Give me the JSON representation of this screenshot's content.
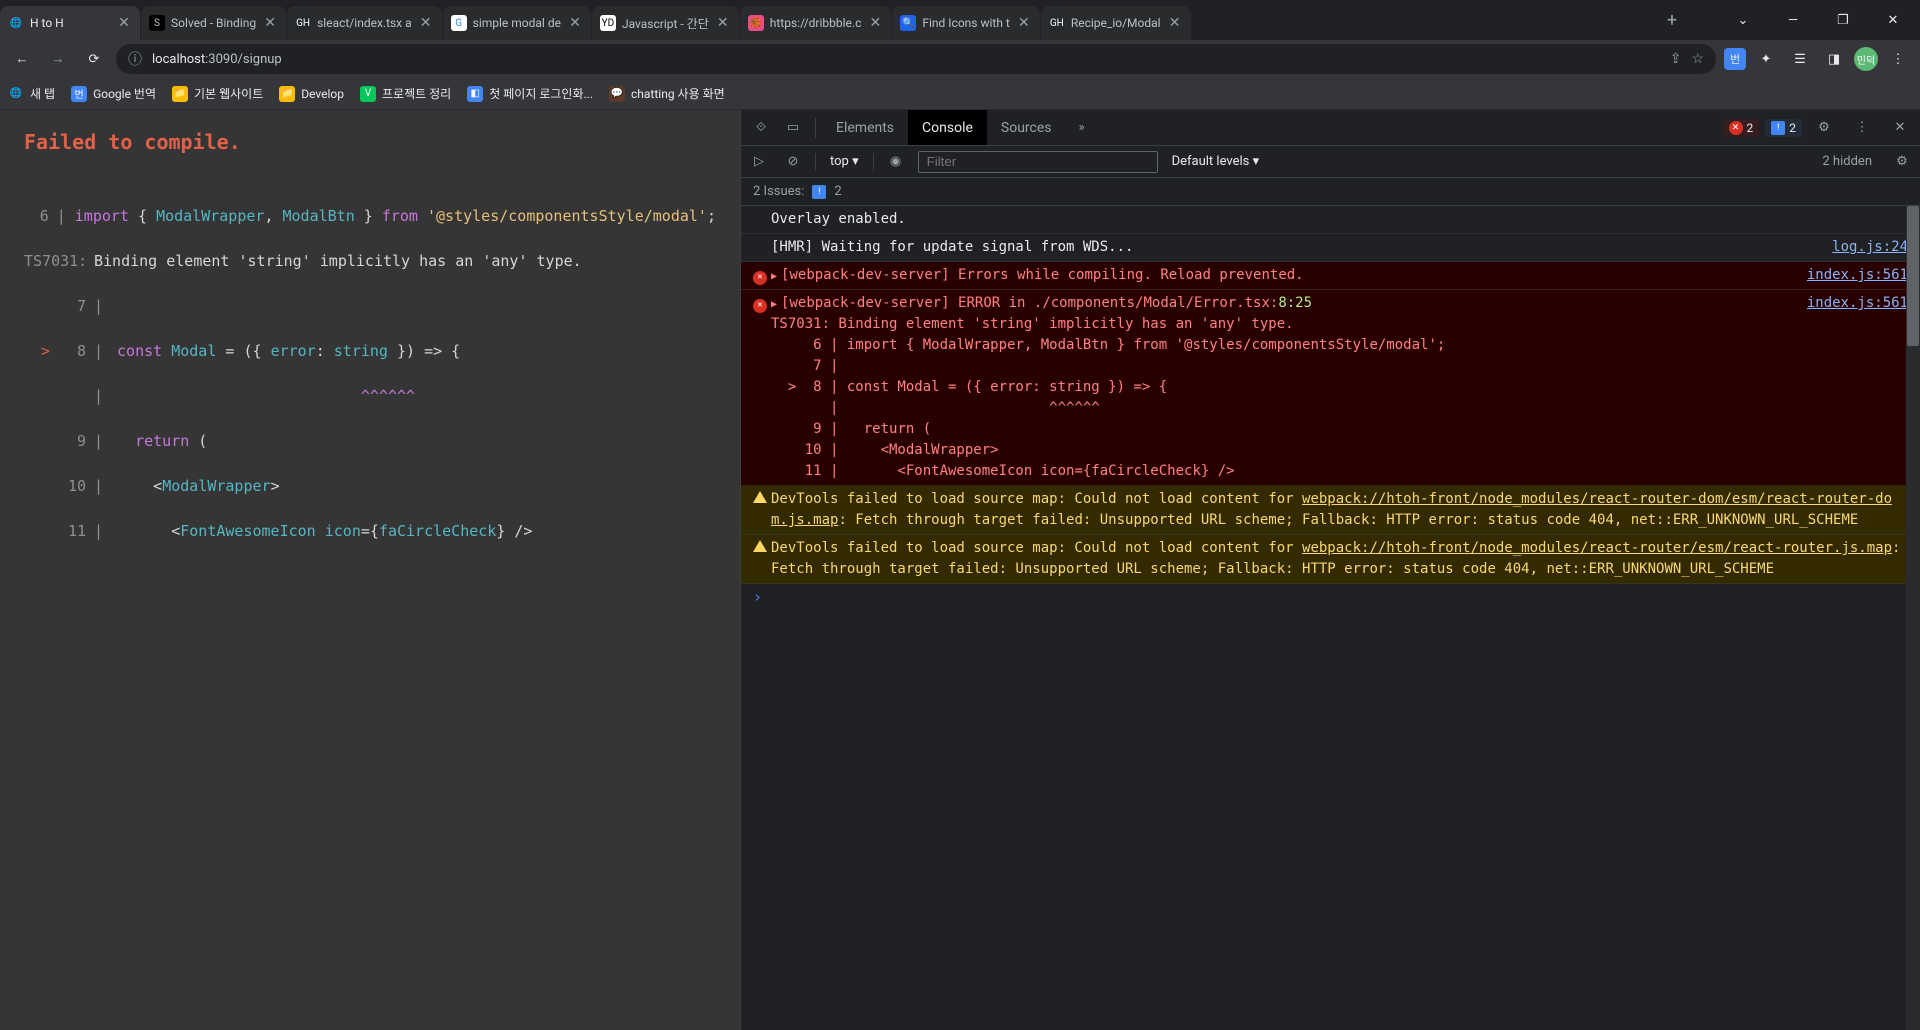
{
  "browser": {
    "tabs": [
      {
        "icon": "🌐",
        "title": "H to H",
        "active": true
      },
      {
        "icon": "S",
        "title": "Solved - Binding",
        "bg": "#000"
      },
      {
        "icon": "GH",
        "title": "sleact/index.tsx a",
        "bg": "#24292e",
        "fg": "#fff"
      },
      {
        "icon": "G",
        "title": "simple modal de",
        "bg": "#fff",
        "fg": "#4285f4"
      },
      {
        "icon": "YD",
        "title": "Javascript - 간단",
        "bg": "#fff",
        "fg": "#000"
      },
      {
        "icon": "🏀",
        "title": "https://dribbble.c",
        "bg": "#ea4c89"
      },
      {
        "icon": "🔍",
        "title": "Find Icons with t",
        "bg": "#1e64f0",
        "fg": "#fff"
      },
      {
        "icon": "GH",
        "title": "Recipe_io/Modal",
        "bg": "#24292e",
        "fg": "#fff"
      }
    ],
    "url_host": "localhost",
    "url_port": ":3090",
    "url_path": "/signup"
  },
  "bookmarks": [
    {
      "icon": "🌐",
      "label": "새 탭"
    },
    {
      "icon": "번",
      "label": "Google 번역",
      "bg": "#4285f4",
      "fg": "#fff"
    },
    {
      "icon": "📁",
      "label": "기본 웹사이트",
      "bg": "#fbbc04"
    },
    {
      "icon": "📁",
      "label": "Develop",
      "bg": "#fbbc04"
    },
    {
      "icon": "V",
      "label": "프로젝트 정리",
      "bg": "#03c75a",
      "fg": "#fff"
    },
    {
      "icon": "◧",
      "label": "첫 페이지 로그인화...",
      "bg": "#4285f4",
      "fg": "#fff"
    },
    {
      "icon": "💬",
      "label": "chatting 사용 화면",
      "bg": "#5b3a29"
    }
  ],
  "left": {
    "title": "Failed to compile.",
    "err_prefix": "TS7031: ",
    "err_text": "Binding element 'string' implicitly has an 'any' type.",
    "lines": {
      "l6_gutter": "6",
      "l6": "import { ModalWrapper, ModalBtn } from '@styles/componentsStyle/modal';",
      "l7_gutter": "7",
      "l8_mark": ">",
      "l8_gutter": "8",
      "l8": "const Modal = ({ error: string }) => {",
      "caret_gutter": "",
      "caret": "                            ^^^^^^",
      "l9_gutter": "9",
      "l9": "  return (",
      "l10_gutter": "10",
      "l10": "    <ModalWrapper>",
      "l11_gutter": "11",
      "l11": "      <FontAwesomeIcon icon={faCircleCheck} />"
    }
  },
  "devtools": {
    "tabs": [
      "Elements",
      "Console",
      "Sources"
    ],
    "active_tab": "Console",
    "errors_count": "2",
    "info_count": "2",
    "top": "top ▾",
    "filter_placeholder": "Filter",
    "levels": "Default levels ▾",
    "hidden": "2 hidden",
    "issues": "2 Issues:",
    "issues_count": "2"
  },
  "console": {
    "log1": "Overlay enabled.",
    "log2": "[HMR] Waiting for update signal from WDS...",
    "log2_src": "log.js:24",
    "err1": "[webpack-dev-server] Errors while compiling. Reload prevented.",
    "err1_src": "index.js:561",
    "err2_l1": "[webpack-dev-server] ERROR in ./components/Modal/Error.tsx:",
    "err2_loc": "8:25",
    "err2_l2": "TS7031: Binding element 'string' implicitly has an 'any' type.",
    "err2_l3": "     6 | import { ModalWrapper, ModalBtn } from '@styles/componentsStyle/modal';",
    "err2_l4": "     7 |",
    "err2_l5": "  >  8 | const Modal = ({ error: string }) => {",
    "err2_l6": "       |                         ^^^^^^",
    "err2_l7": "     9 |   return (",
    "err2_l8": "    10 |     <ModalWrapper>",
    "err2_l9": "    11 |       <FontAwesomeIcon icon={faCircleCheck} />",
    "err2_src": "index.js:561",
    "warn1_a": "DevTools failed to load source map: Could not load content for ",
    "warn1_link": "webpack://htoh-front/node_modules/react-router-dom/esm/react-router-dom.js.map",
    "warn1_b": ": Fetch through target failed: Unsupported URL scheme; Fallback: HTTP error: status code 404, net::ERR_UNKNOWN_URL_SCHEME",
    "warn2_a": "DevTools failed to load source map: Could not load content for ",
    "warn2_link": "webpack://htoh-front/node_modules/react-router/esm/react-router.js.map",
    "warn2_b": ": Fetch through target failed: Unsupported URL scheme; Fallback: HTTP error: status code 404, net::ERR_UNKNOWN_URL_SCHEME",
    "prompt": "›"
  }
}
